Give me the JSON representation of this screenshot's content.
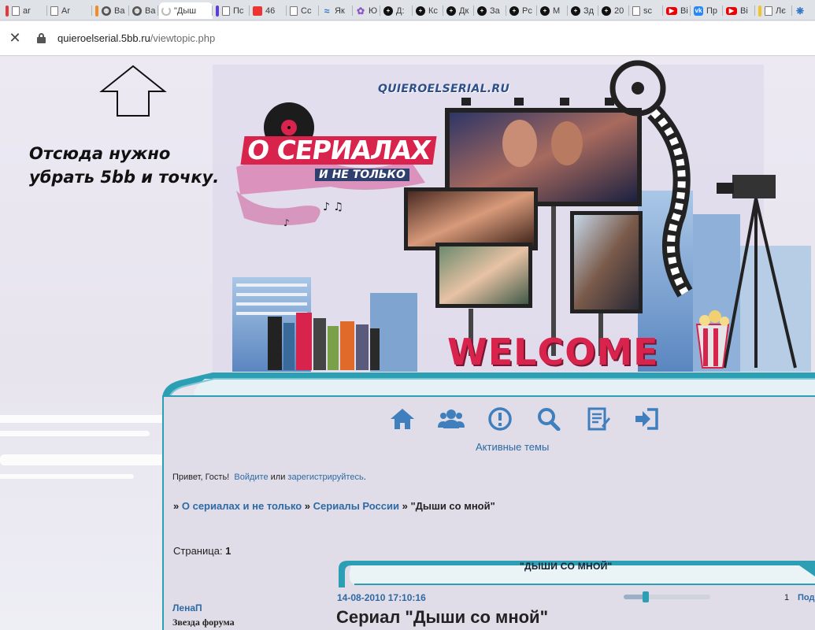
{
  "browser": {
    "tabs": [
      {
        "label": "ar",
        "icon": "document-icon",
        "color": "#e0393e"
      },
      {
        "label": "Ar",
        "icon": "document-icon",
        "color": ""
      },
      {
        "label": "Ba",
        "icon": "globe-icon",
        "color": "#f28c28"
      },
      {
        "label": "Ba",
        "icon": "globe-icon",
        "color": ""
      },
      {
        "label": "\"Дыш",
        "icon": "loading-icon",
        "color": "",
        "active": true
      },
      {
        "label": "Пс",
        "icon": "document-icon",
        "color": "#5b3fd0"
      },
      {
        "label": "46",
        "icon": "mail-icon",
        "color": ""
      },
      {
        "label": "Сс",
        "icon": "document-icon",
        "color": ""
      },
      {
        "label": "Як",
        "icon": "wave-icon",
        "color": ""
      },
      {
        "label": "Ю",
        "icon": "flower-icon",
        "color": ""
      },
      {
        "label": "Д:",
        "icon": "plus-circle-icon",
        "color": ""
      },
      {
        "label": "Кс",
        "icon": "plus-circle-icon",
        "color": ""
      },
      {
        "label": "Дк",
        "icon": "plus-circle-icon",
        "color": ""
      },
      {
        "label": "За",
        "icon": "plus-circle-icon",
        "color": ""
      },
      {
        "label": "Рс",
        "icon": "plus-circle-icon",
        "color": ""
      },
      {
        "label": "М",
        "icon": "plus-circle-icon",
        "color": ""
      },
      {
        "label": "Зд",
        "icon": "plus-circle-icon",
        "color": ""
      },
      {
        "label": "20",
        "icon": "plus-circle-icon",
        "color": ""
      },
      {
        "label": "sc",
        "icon": "document-icon",
        "color": ""
      },
      {
        "label": "Ві",
        "icon": "youtube-icon",
        "color": ""
      },
      {
        "label": "Пр",
        "icon": "vk-icon",
        "color": ""
      },
      {
        "label": "Ві",
        "icon": "youtube-icon",
        "color": ""
      },
      {
        "label": "Лє",
        "icon": "document-icon",
        "color": "#f2c428"
      },
      {
        "label": "",
        "icon": "snowflake-icon",
        "color": ""
      }
    ],
    "url_domain": "quieroelserial.5bb.ru",
    "url_path": "/viewtopic.php"
  },
  "annotation": {
    "line1": "Отсюда нужно",
    "line2": "убрать 5bb и точку."
  },
  "header": {
    "site_name": "QUIEROELSERIAL.RU",
    "logo_main": "О СЕРИАЛАХ",
    "logo_sub": "И НЕ ТОЛЬКО",
    "welcome": "WELCOME"
  },
  "menu": {
    "icons": [
      "home-icon",
      "users-icon",
      "rules-icon",
      "search-icon",
      "register-icon",
      "login-icon"
    ],
    "active_topics": "Активные темы"
  },
  "greeting": {
    "prefix": "Привет, Гость!",
    "login": "Войдите",
    "or": "или",
    "register": "зарегистрируйтесь",
    "suffix": "."
  },
  "breadcrumb": {
    "sep": "»",
    "items": [
      "О сериалах и не только",
      "Сериалы России"
    ],
    "current": "\"Дыши со мной\""
  },
  "pagination": {
    "label": "Страница:",
    "current": "1"
  },
  "topic": {
    "title": "\"ДЫШИ СО МНОЙ\""
  },
  "post": {
    "date": "14-08-2010 17:10:16",
    "number": "1",
    "more_link": "Под",
    "slider_level": 0.25,
    "author": "ЛенаП",
    "author_rank": "Звезда форума",
    "heading": "Сериал \"Дыши со мной\""
  }
}
